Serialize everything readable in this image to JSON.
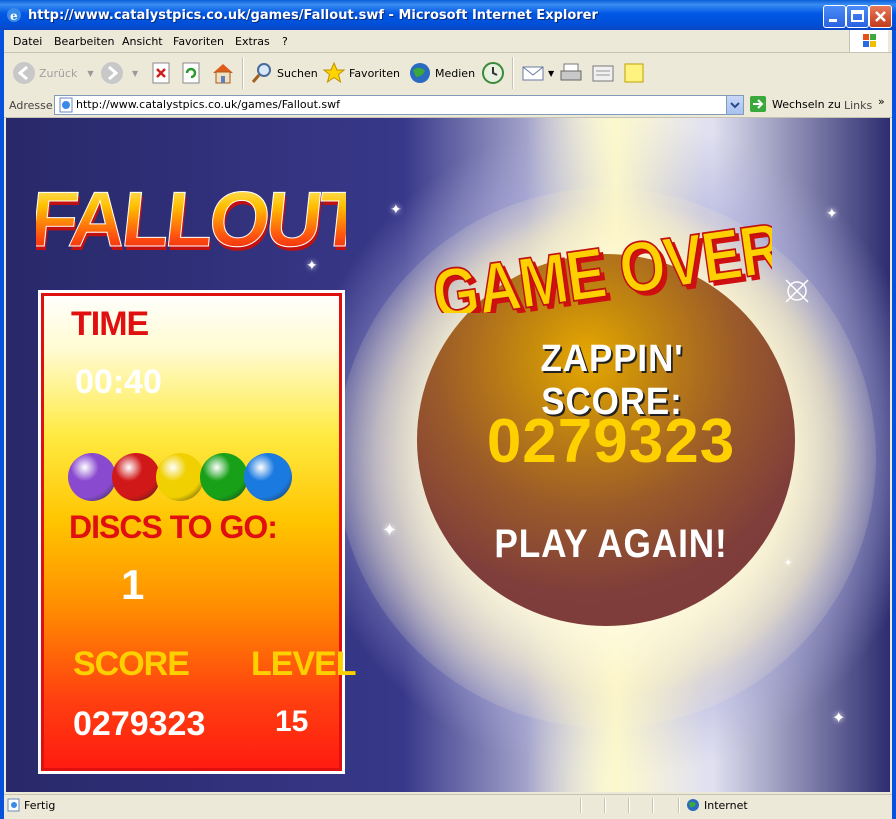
{
  "window": {
    "title": "http://www.catalystpics.co.uk/games/Fallout.swf - Microsoft Internet Explorer"
  },
  "menu": [
    "Datei",
    "Bearbeiten",
    "Ansicht",
    "Favoriten",
    "Extras",
    "?"
  ],
  "toolbar": {
    "back": "Zurück",
    "search": "Suchen",
    "favorites": "Favoriten",
    "media": "Medien"
  },
  "address": {
    "label": "Adresse",
    "url": "http://www.catalystpics.co.uk/games/Fallout.swf",
    "go": "Wechseln zu",
    "links": "Links"
  },
  "game": {
    "logo": "FALLOUT",
    "time_label": "TIME",
    "time_value": "00:40",
    "discs": [
      {
        "color": "#8a4ad0",
        "name": "purple-disc"
      },
      {
        "color": "#d01818",
        "name": "red-disc"
      },
      {
        "color": "#f0d000",
        "name": "yellow-disc"
      },
      {
        "color": "#18a018",
        "name": "green-disc"
      },
      {
        "color": "#1a7ae0",
        "name": "blue-disc"
      }
    ],
    "discs_label": "DISCS TO GO:",
    "discs_value": "1",
    "score_label": "SCORE",
    "score_value": "0279323",
    "level_label": "LEVEL",
    "level_value": "15",
    "game_over": "GAME OVER!",
    "zappin_label": "ZAPPIN' SCORE:",
    "zappin_score": "0279323",
    "play_again": "PLAY AGAIN!"
  },
  "status": {
    "text": "Fertig",
    "zone": "Internet"
  }
}
